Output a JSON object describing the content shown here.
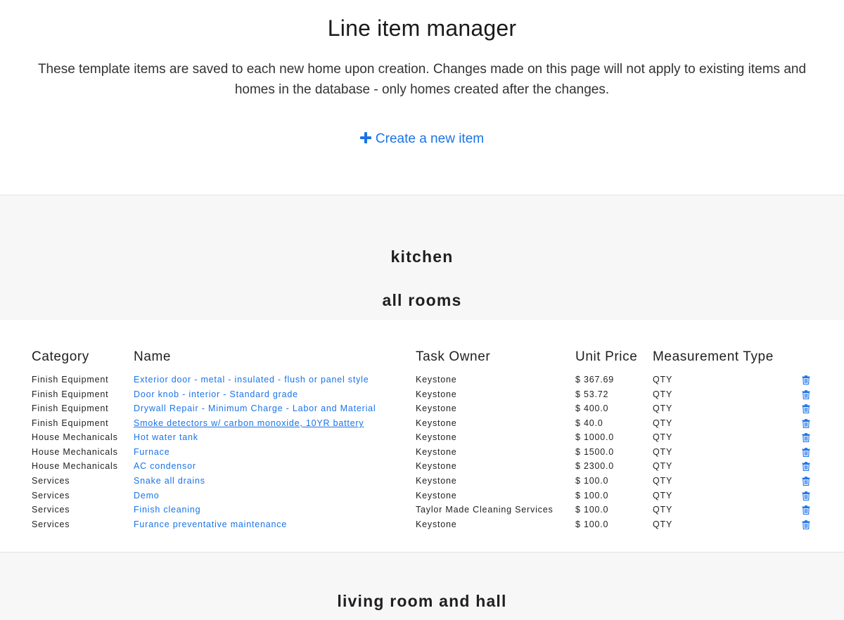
{
  "header": {
    "title": "Line item manager",
    "description": "These template items are saved to each new home upon creation. Changes made on this page will not apply to existing items and homes in the database - only homes created after the changes.",
    "create_label": "Create a new item"
  },
  "rooms": [
    {
      "title": "kitchen"
    },
    {
      "title": "all rooms"
    },
    {
      "title": "living room and hall"
    }
  ],
  "table": {
    "columns": {
      "category": "Category",
      "name": "Name",
      "task_owner": "Task Owner",
      "unit_price": "Unit Price",
      "measurement_type": "Measurement Type"
    },
    "rows": [
      {
        "category": "Finish Equipment",
        "name": "Exterior door - metal - insulated - flush or panel style",
        "owner": "Keystone",
        "price": "$ 367.69",
        "measurement": "QTY"
      },
      {
        "category": "Finish Equipment",
        "name": "Door knob - interior - Standard grade",
        "owner": "Keystone",
        "price": "$ 53.72",
        "measurement": "QTY"
      },
      {
        "category": "Finish Equipment",
        "name": "Drywall Repair - Minimum Charge - Labor and Material",
        "owner": "Keystone",
        "price": "$ 400.0",
        "measurement": "QTY"
      },
      {
        "category": "Finish Equipment",
        "name": "Smoke detectors w/ carbon monoxide, 10YR battery",
        "owner": "Keystone",
        "price": "$ 40.0",
        "measurement": "QTY"
      },
      {
        "category": "House Mechanicals",
        "name": "Hot water tank",
        "owner": "Keystone",
        "price": "$ 1000.0",
        "measurement": "QTY"
      },
      {
        "category": "House Mechanicals",
        "name": "Furnace",
        "owner": "Keystone",
        "price": "$ 1500.0",
        "measurement": "QTY"
      },
      {
        "category": "House Mechanicals",
        "name": "AC condensor",
        "owner": "Keystone",
        "price": "$ 2300.0",
        "measurement": "QTY"
      },
      {
        "category": "Services",
        "name": "Snake all drains",
        "owner": "Keystone",
        "price": "$ 100.0",
        "measurement": "QTY"
      },
      {
        "category": "Services",
        "name": "Demo",
        "owner": "Keystone",
        "price": "$ 100.0",
        "measurement": "QTY"
      },
      {
        "category": "Services",
        "name": "Finish cleaning",
        "owner": "Taylor Made Cleaning Services",
        "price": "$ 100.0",
        "measurement": "QTY"
      },
      {
        "category": "Services",
        "name": "Furance preventative maintenance",
        "owner": "Keystone",
        "price": "$ 100.0",
        "measurement": "QTY"
      }
    ]
  },
  "icons": {
    "create": "plus-icon",
    "delete": "trash-icon"
  },
  "colors": {
    "link": "#1a73e8",
    "band": "#f7f7f7"
  }
}
